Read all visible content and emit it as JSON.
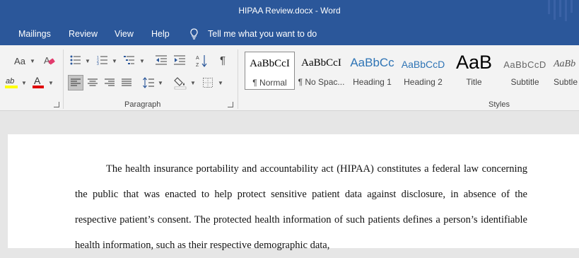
{
  "window": {
    "title": "HIPAA Review.docx  -  Word"
  },
  "ribbon": {
    "tabs": [
      "Mailings",
      "Review",
      "View",
      "Help"
    ],
    "tell_me": "Tell me what you want to do",
    "font_group": {
      "change_case_label": "Aa"
    },
    "paragraph_group": {
      "label": "Paragraph"
    },
    "styles_group": {
      "label": "Styles",
      "styles": [
        {
          "sample": "AaBbCcI",
          "name": "¶ Normal"
        },
        {
          "sample": "AaBbCcI",
          "name": "¶ No Spac..."
        },
        {
          "sample": "AaBbCc",
          "name": "Heading 1"
        },
        {
          "sample": "AaBbCcD",
          "name": "Heading 2"
        },
        {
          "sample": "AaB",
          "name": "Title"
        },
        {
          "sample": "AaBbCcD",
          "name": "Subtitle"
        },
        {
          "sample": "AaBb",
          "name": "Subtle"
        }
      ]
    }
  },
  "document": {
    "paragraph": "The health insurance portability and accountability act (HIPAA) constitutes a federal law concerning the public that was enacted to help protect sensitive patient data against disclosure, in absence of the respective patient’s consent. The protected health information of such patients defines a person’s identifiable health information, such as their respective demographic data,"
  },
  "colors": {
    "title_bar": "#2b579a",
    "ribbon_bg": "#f3f3f3",
    "doc_bg": "#e6e6e6",
    "page_bg": "#ffffff",
    "heading_blue": "#2e74b5",
    "highlight_yellow": "#ffff00",
    "font_color_red": "#e00000"
  },
  "icons": [
    "change-case-icon",
    "clear-formatting-icon",
    "text-highlight-icon",
    "font-color-icon",
    "bullets-icon",
    "numbering-icon",
    "multilevel-list-icon",
    "decrease-indent-icon",
    "increase-indent-icon",
    "sort-icon",
    "show-formatting-marks-icon",
    "align-left-icon",
    "align-center-icon",
    "align-right-icon",
    "justify-icon",
    "line-spacing-icon",
    "shading-icon",
    "borders-icon",
    "lightbulb-icon",
    "dialog-launcher-icon"
  ]
}
